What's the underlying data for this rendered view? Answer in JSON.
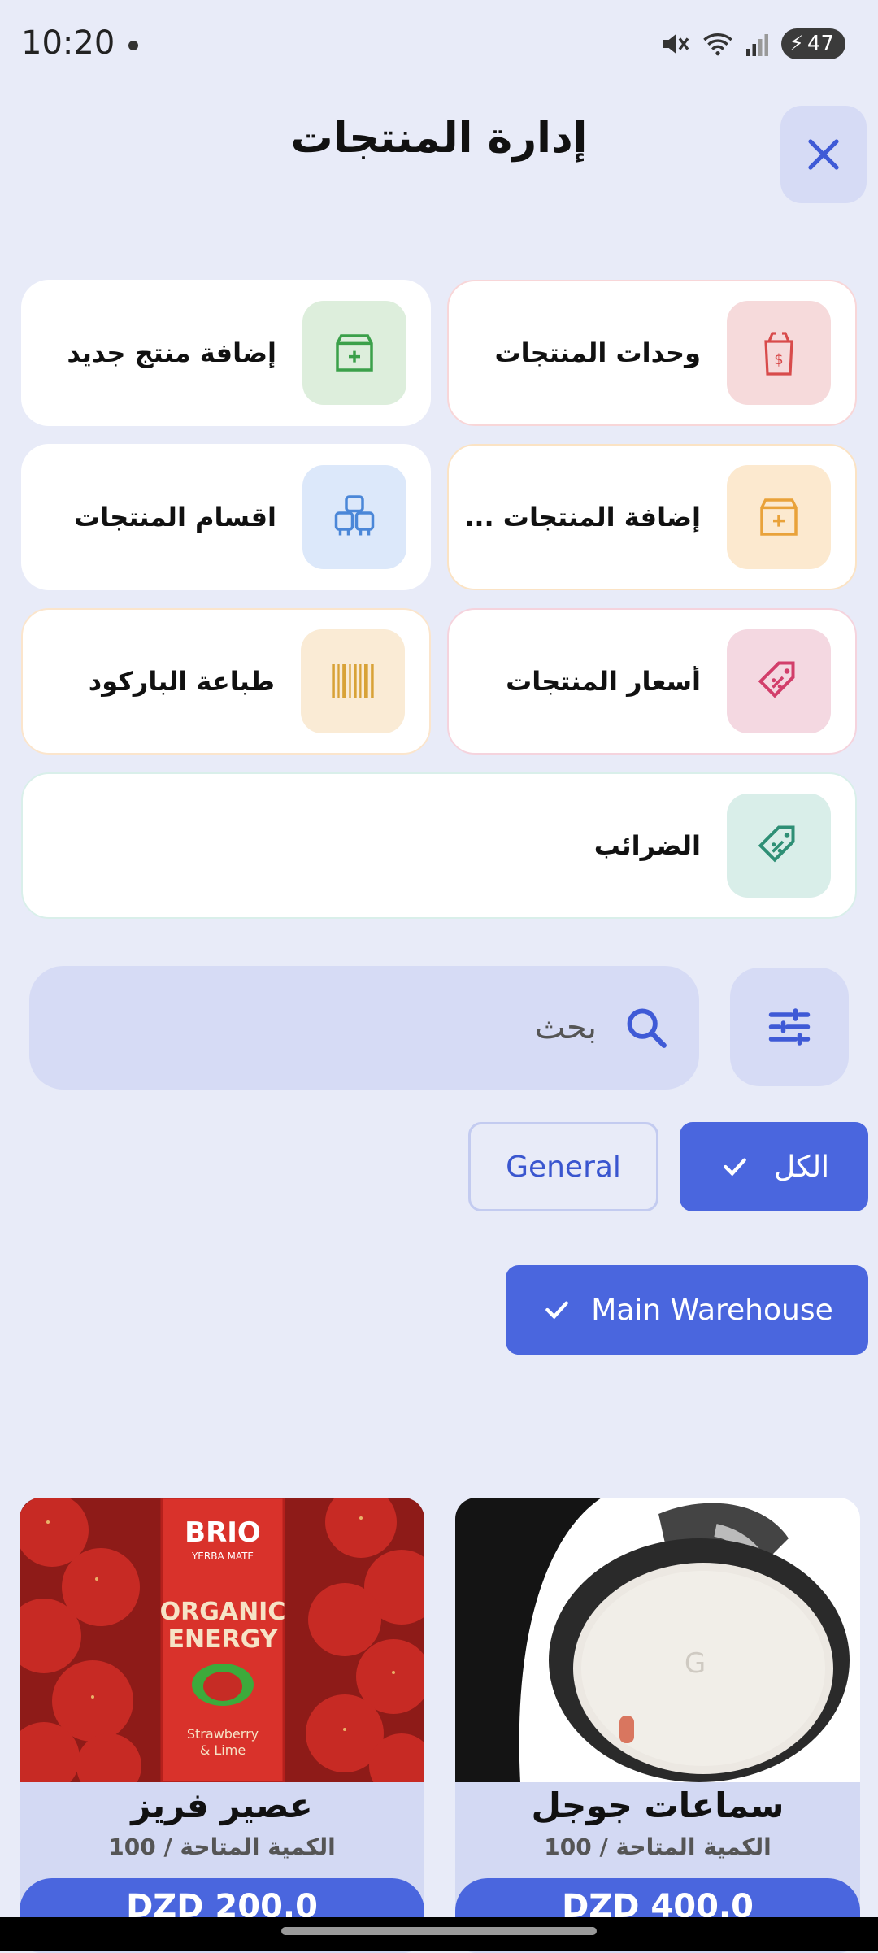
{
  "status": {
    "time": "10:20",
    "battery": "47"
  },
  "header": {
    "title": "إدارة المنتجات"
  },
  "menu": {
    "units": "وحدات المنتجات",
    "add_new": "إضافة منتج جديد",
    "bulk_add": "إضافة المنتجات ...",
    "categories": "اقسام المنتجات",
    "prices": "أسعار المنتجات",
    "barcode": "طباعة الباركود",
    "taxes": "الضرائب"
  },
  "search": {
    "placeholder": "بحث"
  },
  "filters": {
    "categories": [
      {
        "label": "الكل",
        "selected": true
      },
      {
        "label": "General",
        "selected": false
      }
    ],
    "warehouse": {
      "label": "Main Warehouse",
      "selected": true
    }
  },
  "products": [
    {
      "name": "سماعات جوجل",
      "qty": "الكمية المتاحة / 100",
      "price": "DZD 400.0"
    },
    {
      "name": "عصير فريز",
      "qty": "الكمية المتاحة / 100",
      "price": "DZD 200.0"
    }
  ],
  "image_text": {
    "brand": "BRIO",
    "brand_sub": "YERBA MATE",
    "line1": "ORGANIC",
    "line2": "ENERGY",
    "flavor1": "Strawberry",
    "flavor2": "& Lime"
  },
  "colors": {
    "accent": "#4A66DE",
    "bg": "#E8EBF8",
    "chip_bg": "#D6DBF5"
  }
}
